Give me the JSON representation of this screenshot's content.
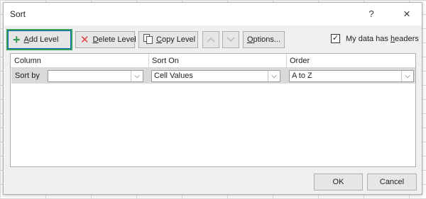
{
  "window": {
    "title": "Sort",
    "help_label": "?",
    "close_label": "×"
  },
  "toolbar": {
    "add_level_prefix": "",
    "add_level_accel": "A",
    "add_level_rest": "dd Level",
    "delete_level_prefix": "",
    "delete_level_accel": "D",
    "delete_level_rest": "elete Level",
    "copy_level_prefix": "",
    "copy_level_accel": "C",
    "copy_level_rest": "opy Level",
    "move_up_icon": "chevron-up-icon",
    "move_down_icon": "chevron-down-icon",
    "options_prefix": "",
    "options_accel": "O",
    "options_rest": "ptions..."
  },
  "headers_checkbox": {
    "label_prefix": "My data has ",
    "label_accel": "h",
    "label_rest": "eaders",
    "checked": true,
    "check_glyph": "✓"
  },
  "grid": {
    "columns": [
      "Column",
      "Sort On",
      "Order"
    ],
    "rows": [
      {
        "label": "Sort by",
        "column_value": "",
        "sort_on_value": "Cell Values",
        "order_value": "A to Z"
      }
    ]
  },
  "footer": {
    "ok_label": "OK",
    "cancel_label": "Cancel"
  },
  "colors": {
    "focus_outline": "#2fa15a",
    "add_icon": "#2f9b4e",
    "delete_icon": "#e03c3c",
    "selected_row": "#d9d9d9"
  }
}
